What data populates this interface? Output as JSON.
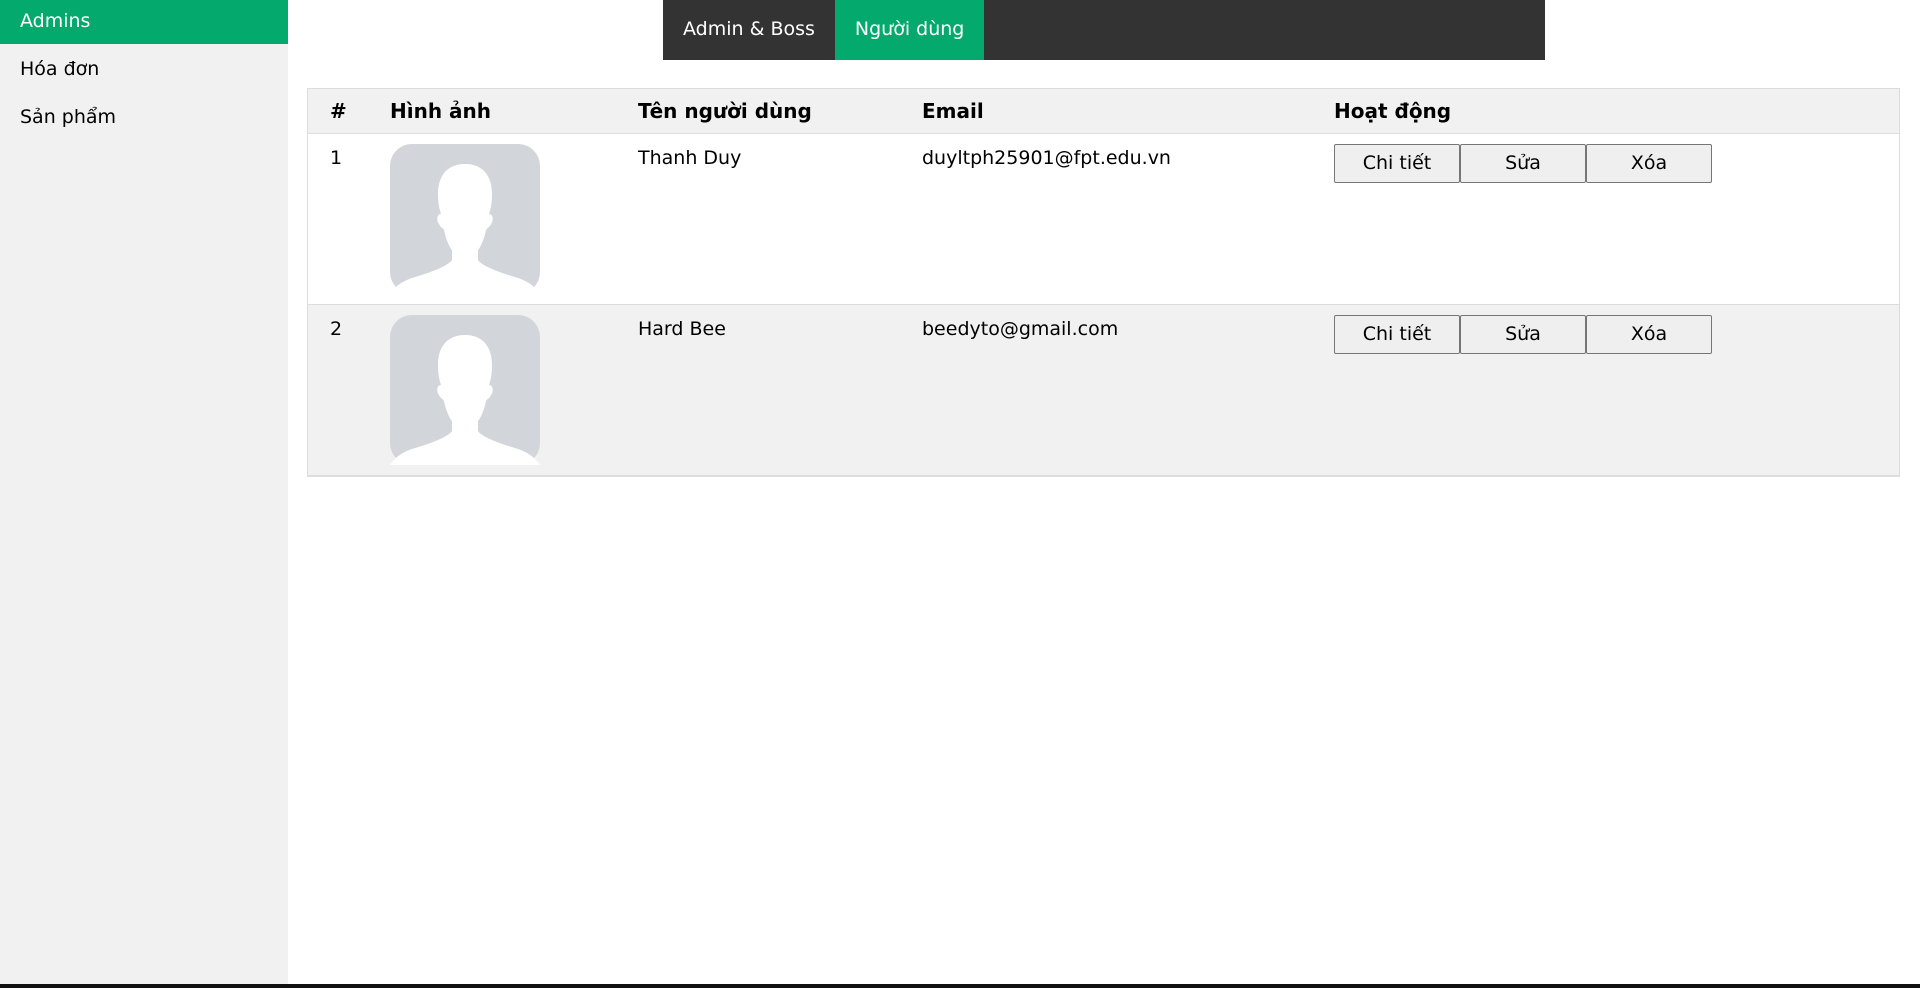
{
  "sidebar": {
    "items": [
      {
        "label": "Admins",
        "active": true
      },
      {
        "label": "Hóa đơn",
        "active": false
      },
      {
        "label": "Sản phẩm",
        "active": false
      }
    ]
  },
  "topnav": {
    "tabs": [
      {
        "label": "Admin & Boss",
        "active": false
      },
      {
        "label": "Người dùng",
        "active": true
      }
    ]
  },
  "table": {
    "headers": {
      "num": "#",
      "image": "Hình ảnh",
      "name": "Tên người dùng",
      "email": "Email",
      "actions": "Hoạt động"
    },
    "rows": [
      {
        "num": "1",
        "image_icon": "user-silhouette-icon",
        "name": "Thanh Duy",
        "email": "duyltph25901@fpt.edu.vn",
        "actions": {
          "detail": "Chi tiết",
          "edit": "Sửa",
          "delete": "Xóa"
        }
      },
      {
        "num": "2",
        "image_icon": "user-silhouette-icon",
        "name": "Hard Bee",
        "email": "beedyto@gmail.com",
        "actions": {
          "detail": "Chi tiết",
          "edit": "Sửa",
          "delete": "Xóa"
        }
      }
    ]
  },
  "colors": {
    "accent": "#04aa6d",
    "nav_bg": "#333333",
    "sidebar_bg": "#f1f1f1",
    "avatar_bg": "#d2d5da"
  }
}
